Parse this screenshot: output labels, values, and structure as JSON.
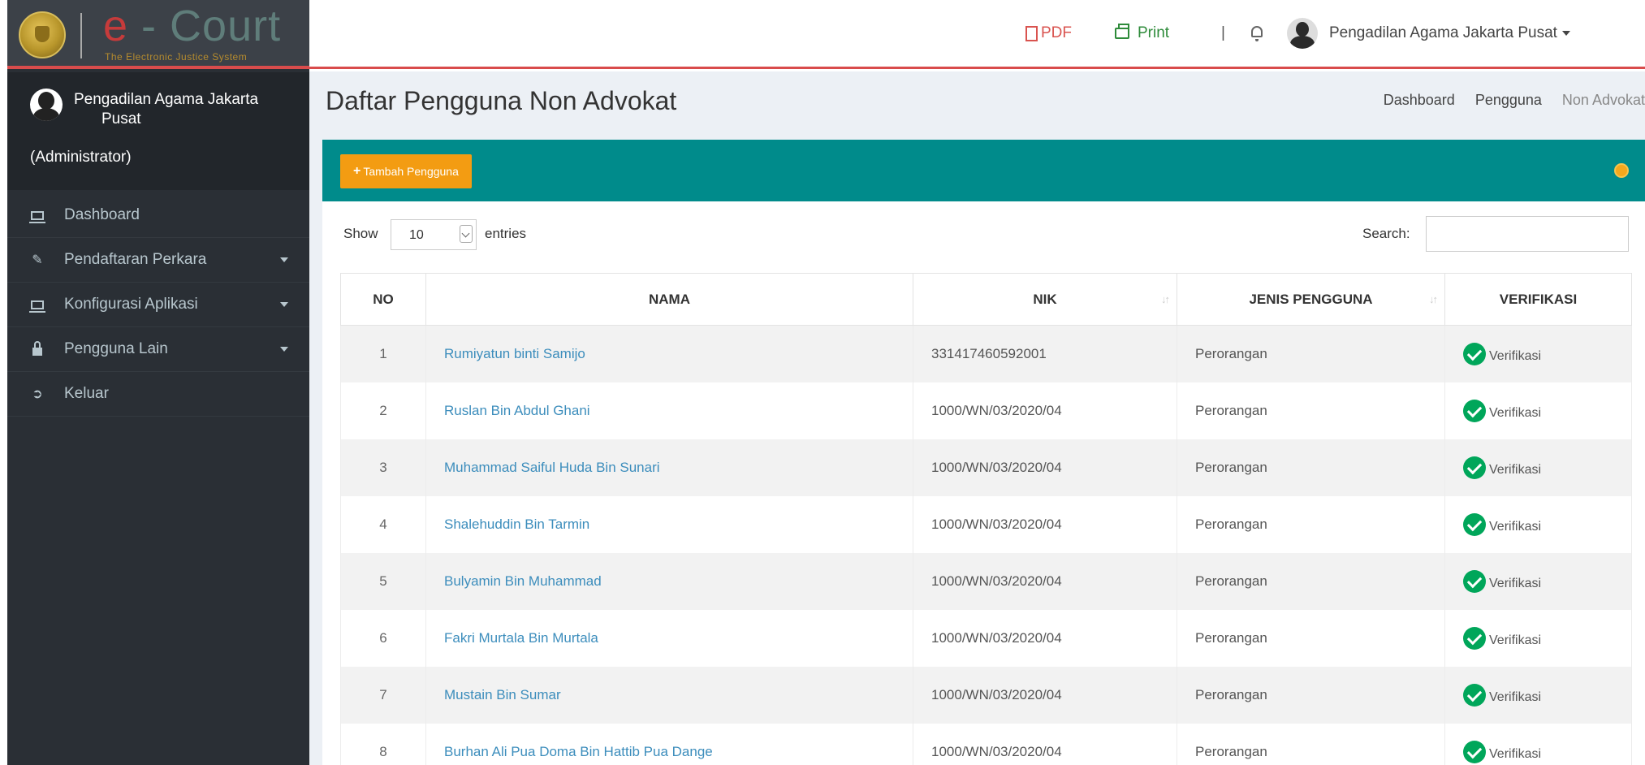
{
  "brand": {
    "title_e": "e",
    "title_dash": " - ",
    "title_court": "Court",
    "subtitle": "The Electronic Justice System"
  },
  "user_panel": {
    "name_line1": "Pengadilan Agama Jakarta",
    "name_line2": "Pusat",
    "role": "(Administrator)"
  },
  "sidebar": {
    "items": [
      {
        "label": "Dashboard",
        "icon": "monitor-icon",
        "has_caret": false
      },
      {
        "label": "Pendaftaran Perkara",
        "icon": "edit-icon",
        "has_caret": true
      },
      {
        "label": "Konfigurasi Aplikasi",
        "icon": "monitor-icon",
        "has_caret": true
      },
      {
        "label": "Pengguna Lain",
        "icon": "lock-icon",
        "has_caret": true
      },
      {
        "label": "Keluar",
        "icon": "sign-out-icon",
        "has_caret": false
      }
    ]
  },
  "topbar": {
    "pdf_label": "PDF",
    "print_label": "Print",
    "separator": "|",
    "user_label": "Pengadilan Agama Jakarta Pusat"
  },
  "page": {
    "title": "Daftar Pengguna Non Advokat",
    "breadcrumb": [
      "Dashboard",
      "Pengguna",
      "Non Advokat"
    ]
  },
  "box": {
    "add_button_label": "Tambah Pengguna"
  },
  "datatable": {
    "show_label": "Show",
    "length_value": "10",
    "entries_label": "entries",
    "search_label": "Search:",
    "search_value": "",
    "columns": [
      "NO",
      "NAMA",
      "NIK",
      "JENIS PENGGUNA",
      "VERIFIKASI"
    ],
    "rows": [
      {
        "no": "1",
        "nama": "Rumiyatun binti Samijo",
        "nik": "331417460592001",
        "jenis": "Perorangan",
        "verifikasi": "Verifikasi"
      },
      {
        "no": "2",
        "nama": "Ruslan Bin Abdul Ghani",
        "nik": "1000/WN/03/2020/04",
        "jenis": "Perorangan",
        "verifikasi": "Verifikasi"
      },
      {
        "no": "3",
        "nama": "Muhammad Saiful Huda Bin Sunari",
        "nik": "1000/WN/03/2020/04",
        "jenis": "Perorangan",
        "verifikasi": "Verifikasi"
      },
      {
        "no": "4",
        "nama": "Shalehuddin Bin Tarmin",
        "nik": "1000/WN/03/2020/04",
        "jenis": "Perorangan",
        "verifikasi": "Verifikasi"
      },
      {
        "no": "5",
        "nama": "Bulyamin Bin Muhammad",
        "nik": "1000/WN/03/2020/04",
        "jenis": "Perorangan",
        "verifikasi": "Verifikasi"
      },
      {
        "no": "6",
        "nama": "Fakri Murtala Bin Murtala",
        "nik": "1000/WN/03/2020/04",
        "jenis": "Perorangan",
        "verifikasi": "Verifikasi"
      },
      {
        "no": "7",
        "nama": "Mustain Bin Sumar",
        "nik": "1000/WN/03/2020/04",
        "jenis": "Perorangan",
        "verifikasi": "Verifikasi"
      },
      {
        "no": "8",
        "nama": "Burhan Ali Pua Doma Bin Hattib Pua Dange",
        "nik": "1000/WN/03/2020/04",
        "jenis": "Perorangan",
        "verifikasi": "Verifikasi"
      }
    ]
  },
  "colors": {
    "sidebar_bg": "#2a2f35",
    "header_teal": "#008b8b",
    "button_orange": "#f39c12",
    "accent_red": "#d94c4c",
    "link_blue": "#3c8dbc",
    "check_green": "#00a65a"
  }
}
